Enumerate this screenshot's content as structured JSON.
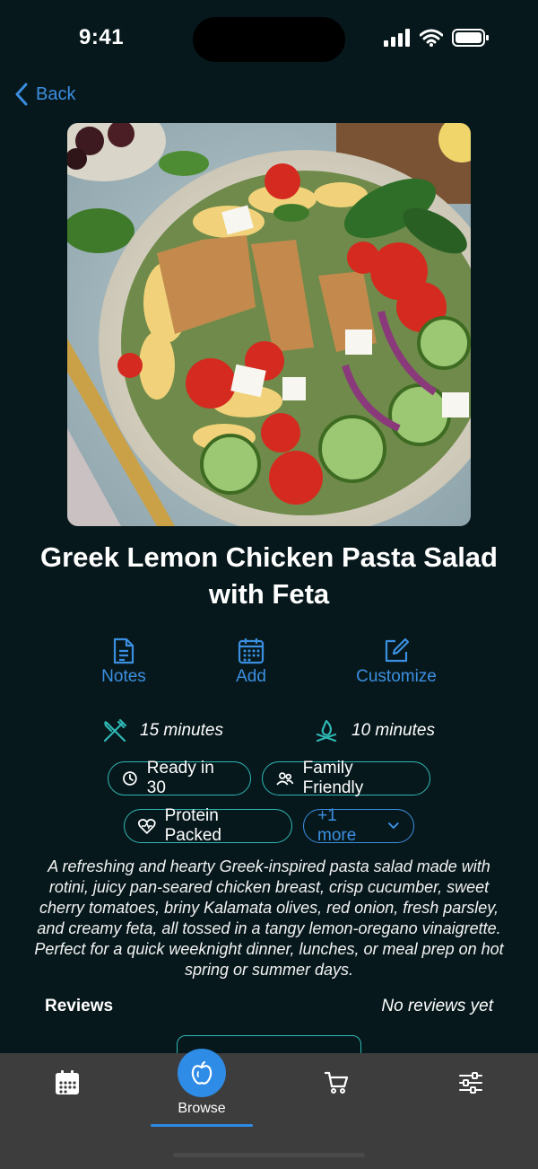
{
  "status": {
    "time": "9:41"
  },
  "nav": {
    "back_label": "Back"
  },
  "recipe": {
    "title": "Greek Lemon Chicken Pasta Salad with Feta",
    "actions": [
      {
        "label": "Notes",
        "icon": "notes-icon"
      },
      {
        "label": "Add",
        "icon": "calendar-icon"
      },
      {
        "label": "Customize",
        "icon": "edit-icon"
      }
    ],
    "prep_time": "15 minutes",
    "cook_time": "10 minutes",
    "tags": [
      "Ready in 30",
      "Family Friendly",
      "Protein Packed"
    ],
    "more_tags": "+1 more",
    "description": "A refreshing and hearty Greek-inspired pasta salad made with rotini, juicy pan-seared chicken breast, crisp cucumber, sweet cherry tomatoes, briny Kalamata olives, red onion, fresh parsley, and creamy feta, all tossed in a tangy lemon-oregano vinaigrette. Perfect for a quick weeknight dinner, lunches, or meal prep on hot spring or summer days.",
    "reviews_label": "Reviews",
    "reviews_status": "No reviews yet"
  },
  "tabbar": {
    "tabs": [
      {
        "icon": "calendar-icon",
        "label": ""
      },
      {
        "icon": "apple-icon",
        "label": "Browse",
        "active": true
      },
      {
        "icon": "cart-icon",
        "label": ""
      },
      {
        "icon": "sliders-icon",
        "label": ""
      }
    ]
  },
  "colors": {
    "accent": "#3b8fe0",
    "teal": "#2fb7b4",
    "background": "#07181c",
    "tabbar": "#3d3d3d"
  }
}
